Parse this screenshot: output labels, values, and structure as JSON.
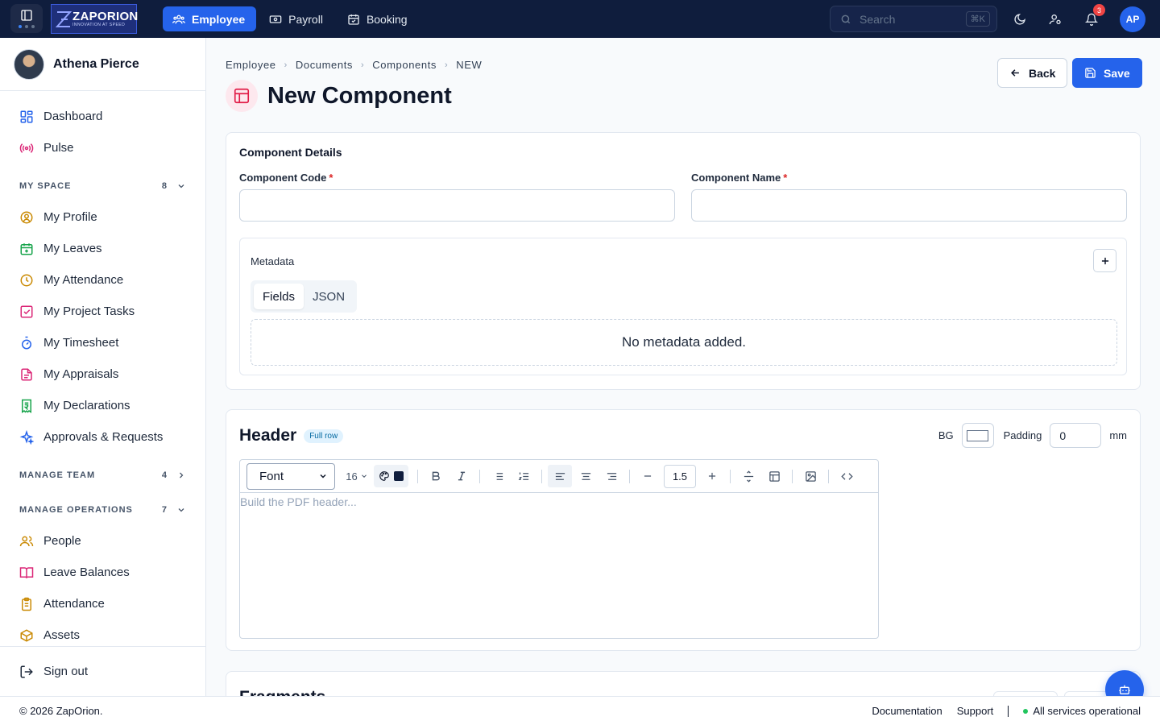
{
  "topbar": {
    "logo_name": "ZAPORION",
    "logo_tagline": "INNOVATION AT SPEED",
    "tabs": [
      {
        "label": "Employee",
        "icon": "users-icon",
        "active": true
      },
      {
        "label": "Payroll",
        "icon": "banknote-icon",
        "active": false
      },
      {
        "label": "Booking",
        "icon": "calendar-check-icon",
        "active": false
      }
    ],
    "search_placeholder": "Search",
    "search_shortcut": "⌘K",
    "notification_count": "3",
    "avatar_initials": "AP"
  },
  "sidebar": {
    "user_name": "Athena Pierce",
    "items_top": [
      "Dashboard",
      "Pulse"
    ],
    "my_space": {
      "label": "MY SPACE",
      "count": "8",
      "items": [
        "My Profile",
        "My Leaves",
        "My Attendance",
        "My Project Tasks",
        "My Timesheet",
        "My Appraisals",
        "My Declarations",
        "Approvals & Requests"
      ]
    },
    "manage_team": {
      "label": "MANAGE TEAM",
      "count": "4"
    },
    "manage_operations": {
      "label": "MANAGE OPERATIONS",
      "count": "7",
      "items": [
        "People",
        "Leave Balances",
        "Attendance",
        "Assets"
      ]
    },
    "sign_out": "Sign out"
  },
  "main": {
    "breadcrumb": [
      "Employee",
      "Documents",
      "Components",
      "NEW"
    ],
    "title": "New Component",
    "back_label": "Back",
    "save_label": "Save",
    "details": {
      "title": "Component Details",
      "code_label": "Component Code",
      "name_label": "Component Name",
      "code_value": "",
      "name_value": "",
      "required_mark": "*",
      "metadata_label": "Metadata",
      "seg_fields": "Fields",
      "seg_json": "JSON",
      "empty_text": "No metadata added."
    },
    "header_section": {
      "title": "Header",
      "pill": "Full row",
      "bg_label": "BG",
      "padding_label": "Padding",
      "padding_value": "0",
      "padding_unit": "mm",
      "font_select": "Font",
      "font_size": "16",
      "line_height": "1.5",
      "placeholder": "Build the PDF header...",
      "text_color": "#0f1d3d"
    },
    "fragments_title": "Fragments"
  },
  "footer": {
    "copyright": "© 2026 ZapOrion.",
    "documentation": "Documentation",
    "support": "Support",
    "status": "All services operational"
  },
  "colors": {
    "accent": "#2563eb",
    "topbar": "#0f1d3d",
    "required": "#dc2626",
    "status_ok": "#22c55e"
  }
}
